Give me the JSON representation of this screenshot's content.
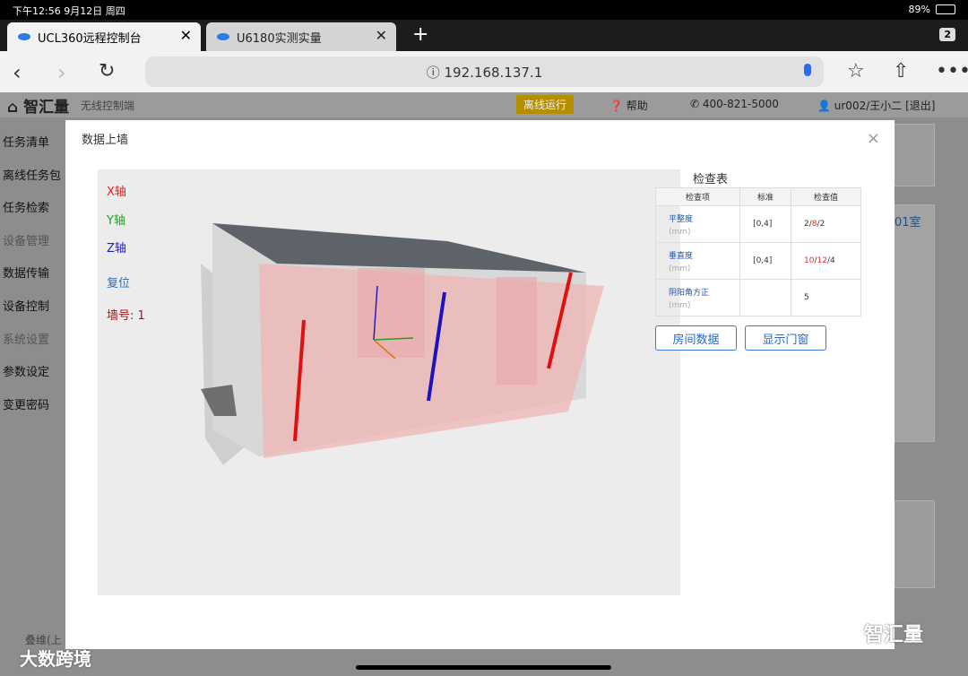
{
  "status": {
    "time": "下午12:56  9月12日 周四",
    "battery": "89%",
    "battery_level": 0.89
  },
  "tabs": [
    {
      "label": "UCL360远程控制台",
      "close": "✕"
    },
    {
      "label": "U6180实测实量",
      "close": "✕"
    }
  ],
  "tab_count": "2",
  "address": "ⓘ 192.168.137.1",
  "header": {
    "logo": "智汇量",
    "subtitle": "无线控制端",
    "offline": "离线运行",
    "help": "帮助",
    "phone": "400-821-5000",
    "user": "ur002/王小二 [退出]"
  },
  "sidebar": [
    "任务清单",
    "离线任务包",
    "任务检索",
    "设备管理",
    "数据传输",
    "设备控制",
    "系统设置",
    "参数设定",
    "变更密码"
  ],
  "bg": {
    "room_label": "01室",
    "bottom_left": "叠维(上"
  },
  "modal": {
    "title": "数据上墙",
    "close": "×",
    "x_axis": "X轴",
    "y_axis": "Y轴",
    "z_axis": "Z轴",
    "reset": "复位",
    "wall_no": "墙号: 1",
    "check_title": "检查表",
    "columns": [
      "检查项",
      "标准",
      "检查值"
    ],
    "rows": [
      {
        "item": "平整度",
        "unit": "(mm)",
        "std": "[0,4]",
        "v1": "2",
        "v2": "8",
        "v3": "2"
      },
      {
        "item": "垂直度",
        "unit": "(mm)",
        "std": "[0,4]",
        "v1": "10",
        "v2": "12",
        "v3": "4"
      },
      {
        "item": "阴阳角方正",
        "unit": "(mm)",
        "std": "",
        "v1": "5",
        "v2": "",
        "v3": ""
      }
    ],
    "btn_room": "房间数据",
    "btn_door": "显示门窗"
  },
  "watermarks": {
    "left": "大数跨境",
    "right": "智汇量"
  },
  "colors": {
    "accent": "#3a7bd5",
    "offline_badge": "#b58e00",
    "fail": "#e03030",
    "x_axis": "#e02020",
    "y_axis": "#20a020",
    "z_axis": "#2020c0",
    "reset": "#2a6cc0",
    "wall": "#a01818"
  }
}
